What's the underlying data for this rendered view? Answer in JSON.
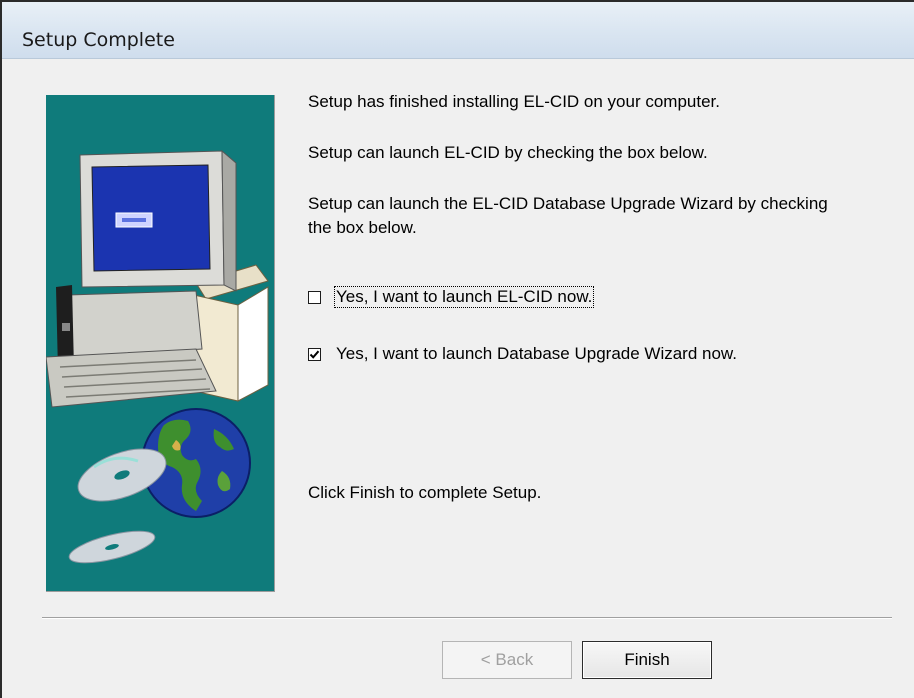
{
  "window": {
    "title": "Setup Complete"
  },
  "messages": {
    "finished": "Setup has finished installing EL-CID on your computer.",
    "launch_app": "Setup can launch EL-CID by checking the box below.",
    "launch_wizard": "Setup can launch the EL-CID Database Upgrade Wizard by checking the box below.",
    "click_finish": "Click Finish to complete Setup."
  },
  "options": [
    {
      "label": "Yes, I want to launch EL-CID now.",
      "checked": false
    },
    {
      "label": "Yes, I want to launch Database Upgrade Wizard now.",
      "checked": true
    }
  ],
  "buttons": {
    "back_label": "< Back",
    "finish_label": "Finish"
  },
  "colors": {
    "art_background": "#0f7b7b",
    "title_gradient_top": "#e9f0f7",
    "dialog_background": "#f0f0f0"
  },
  "art_panel": {
    "icon": "installer-computer-globe-illustration"
  }
}
